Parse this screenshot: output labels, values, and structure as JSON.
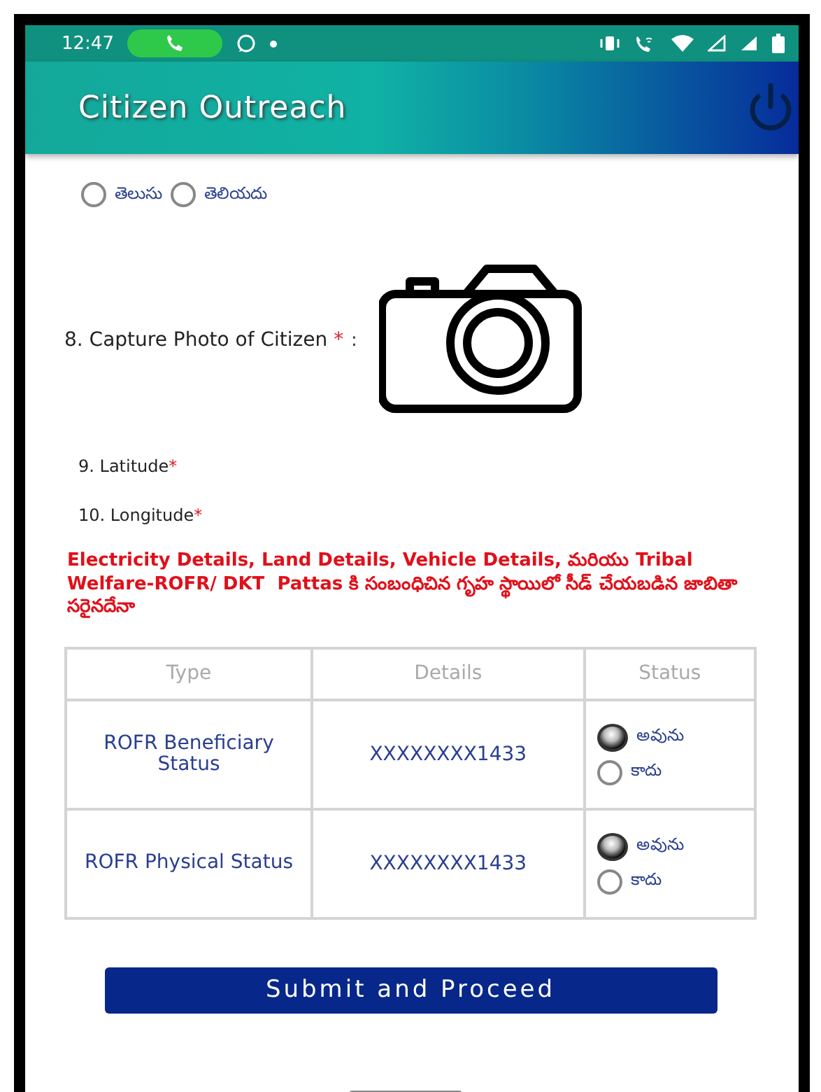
{
  "status_bar": {
    "time": "12:47"
  },
  "header": {
    "title": "Citizen Outreach"
  },
  "question_7": {
    "options": [
      {
        "label": "తెలుసు",
        "selected": false
      },
      {
        "label": "తెలియదు",
        "selected": false
      }
    ]
  },
  "question_8": {
    "label": "8. Capture Photo of Citizen",
    "required_mark": "*",
    "separator": ":"
  },
  "fields": [
    {
      "label": "9. Latitude",
      "required_mark": "*"
    },
    {
      "label": "10. Longitude",
      "required_mark": "*"
    }
  ],
  "notice": "Electricity Details, Land Details, Vehicle Details, మరియు Tribal Welfare-ROFR/ DKT  Pattas కి సంబంధిచిన గృహ స్థాయిలో సీడ్ చేయబడిన జాబితా సరైనదేనా",
  "table": {
    "columns": [
      "Type",
      "Details",
      "Status"
    ],
    "rows": [
      {
        "type": "ROFR Beneficiary Status",
        "details": "XXXXXXXX1433",
        "options": [
          {
            "label": "అవును",
            "selected": true
          },
          {
            "label": "కాదు",
            "selected": false
          }
        ]
      },
      {
        "type": "ROFR Physical Status",
        "details": "XXXXXXXX1433",
        "options": [
          {
            "label": "అవును",
            "selected": true
          },
          {
            "label": "కాదు",
            "selected": false
          }
        ]
      }
    ]
  },
  "submit_button": "Submit and Proceed"
}
